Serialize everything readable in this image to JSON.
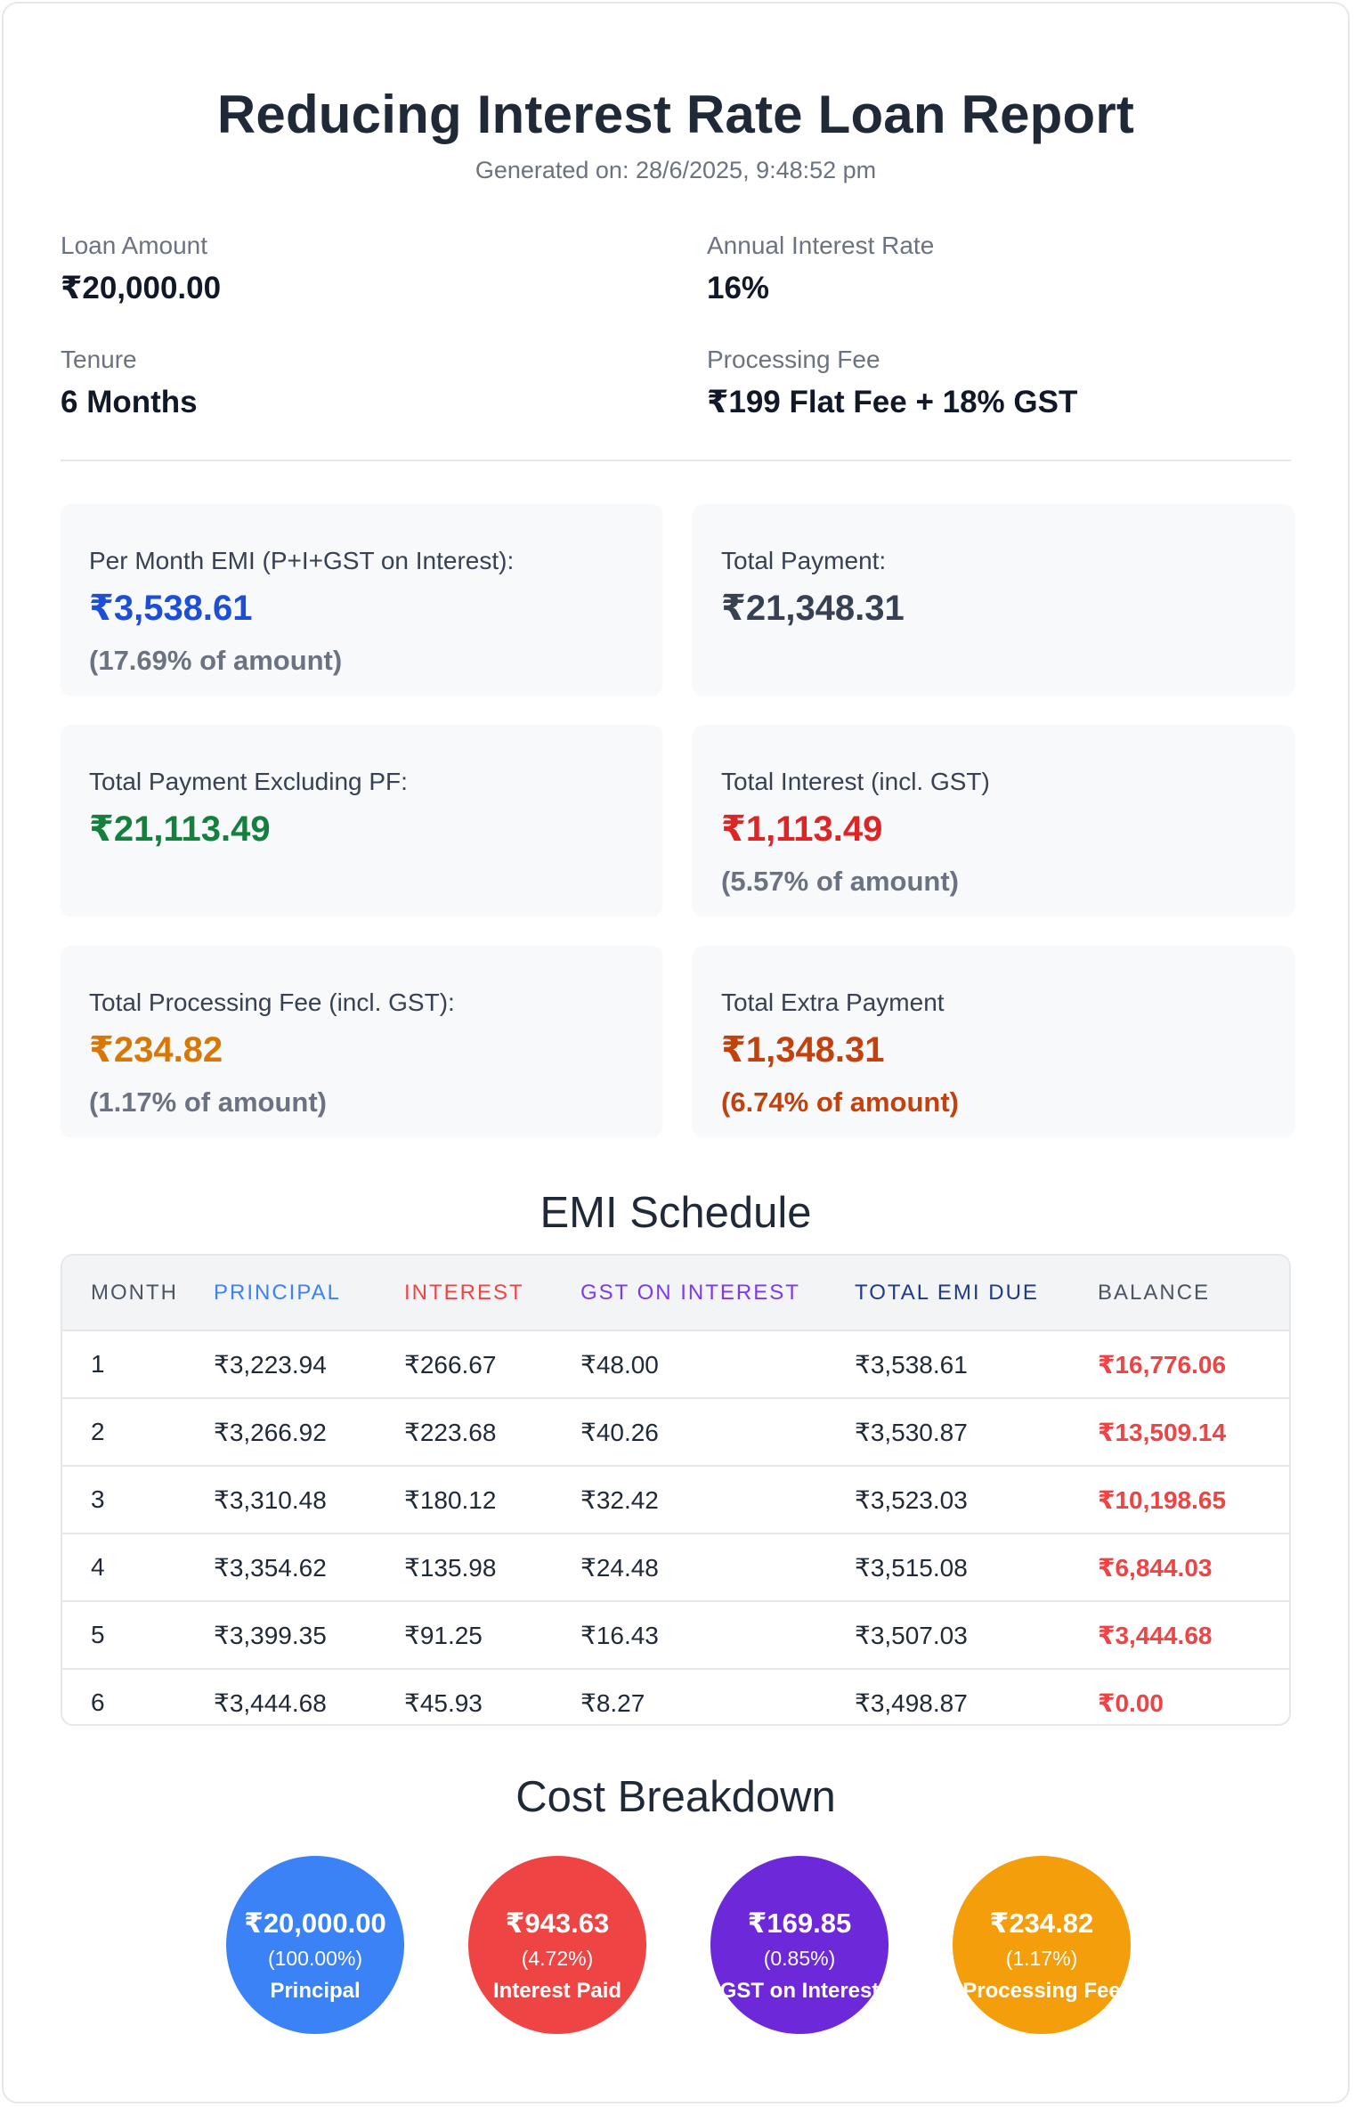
{
  "header": {
    "title": "Reducing Interest Rate Loan Report",
    "generated": "Generated on: 28/6/2025, 9:48:52 pm"
  },
  "loan_info": {
    "loan_amount_label": "Loan Amount",
    "loan_amount": "₹20,000.00",
    "rate_label": "Annual Interest Rate",
    "rate": "16%",
    "tenure_label": "Tenure",
    "tenure": "6 Months",
    "fee_label": "Processing Fee",
    "fee": "₹199 Flat Fee + 18% GST"
  },
  "summary": {
    "emi": {
      "label": "Per Month EMI (P+I+GST on Interest):",
      "amount": "₹3,538.61",
      "pct": "(17.69% of amount)",
      "color": "#1d4ed8"
    },
    "total_payment": {
      "label": "Total Payment:",
      "amount": "₹21,348.31",
      "color": "#374151"
    },
    "total_excl_pf": {
      "label": "Total Payment Excluding PF:",
      "amount": "₹21,113.49",
      "color": "#15803d"
    },
    "total_interest": {
      "label": "Total Interest (incl. GST)",
      "amount": "₹1,113.49",
      "pct": "(5.57% of amount)",
      "color": "#dc2626"
    },
    "total_pf": {
      "label": "Total Processing Fee (incl. GST):",
      "amount": "₹234.82",
      "pct": "(1.17% of amount)",
      "color": "#d97706"
    },
    "total_extra": {
      "label": "Total Extra Payment",
      "amount": "₹1,348.31",
      "pct": "(6.74% of amount)",
      "color": "#c2410c"
    }
  },
  "schedule": {
    "title": "EMI Schedule",
    "headers": [
      "Month",
      "Principal",
      "Interest",
      "GST on Interest",
      "Total EMI Due",
      "Balance"
    ],
    "header_colors": [
      "#4b5563",
      "#3b82f6",
      "#ef4444",
      "#7c3aed",
      "#1e3a8a",
      "#4b5563"
    ],
    "rows": [
      [
        "1",
        "₹3,223.94",
        "₹266.67",
        "₹48.00",
        "₹3,538.61",
        "₹16,776.06"
      ],
      [
        "2",
        "₹3,266.92",
        "₹223.68",
        "₹40.26",
        "₹3,530.87",
        "₹13,509.14"
      ],
      [
        "3",
        "₹3,310.48",
        "₹180.12",
        "₹32.42",
        "₹3,523.03",
        "₹10,198.65"
      ],
      [
        "4",
        "₹3,354.62",
        "₹135.98",
        "₹24.48",
        "₹3,515.08",
        "₹6,844.03"
      ],
      [
        "5",
        "₹3,399.35",
        "₹91.25",
        "₹16.43",
        "₹3,507.03",
        "₹3,444.68"
      ],
      [
        "6",
        "₹3,444.68",
        "₹45.93",
        "₹8.27",
        "₹3,498.87",
        "₹0.00"
      ]
    ]
  },
  "breakdown": {
    "title": "Cost Breakdown",
    "items": [
      {
        "amount": "₹20,000.00",
        "pct": "(100.00%)",
        "label": "Principal",
        "color": "#3b82f6"
      },
      {
        "amount": "₹943.63",
        "pct": "(4.72%)",
        "label": "Interest Paid",
        "color": "#ef4444"
      },
      {
        "amount": "₹169.85",
        "pct": "(0.85%)",
        "label": "GST on Interest",
        "color": "#6d28d9"
      },
      {
        "amount": "₹234.82",
        "pct": "(1.17%)",
        "label": "Processing Fee",
        "color": "#f59e0b"
      }
    ]
  }
}
